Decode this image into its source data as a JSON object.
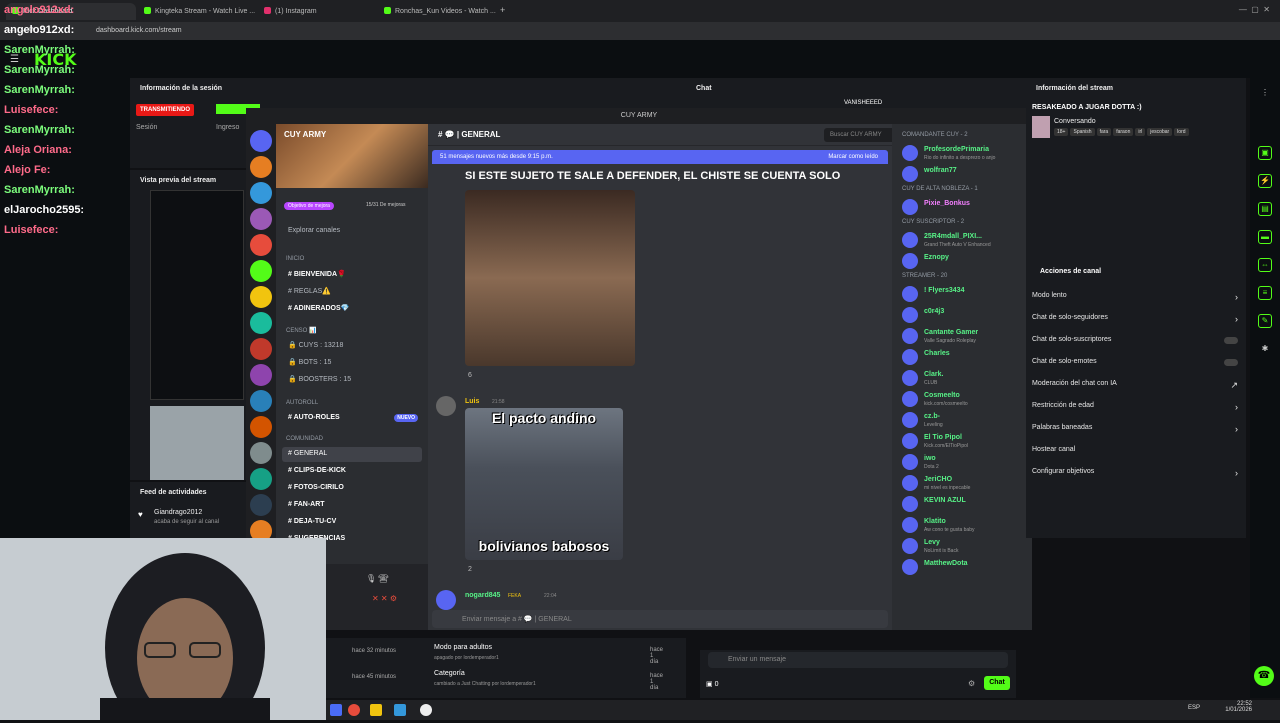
{
  "browser": {
    "tabs": [
      {
        "label": "Kick Dashboard",
        "color": "#53fc18"
      },
      {
        "label": "Kingteka Stream - Watch Live ...",
        "color": "#53fc18"
      },
      {
        "label": "(1) Instagram",
        "color": "#e1306c"
      },
      {
        "label": "Ronchas_Kun Videos - Watch ...",
        "color": "#53fc18"
      }
    ],
    "new_tab": "+",
    "url": "dashboard.kick.com/stream"
  },
  "overlay_chat": [
    {
      "user": "angelo912xd:",
      "color": "#ffffff"
    },
    {
      "user": "SarenMyrrah:",
      "color": "#7cfc7c"
    },
    {
      "user": "SarenMyrrah:",
      "color": "#7cfc7c"
    },
    {
      "user": "SarenMyrrah:",
      "color": "#7cfc7c"
    },
    {
      "user": "Luisefece:",
      "color": "#ff6b8a"
    },
    {
      "user": "SarenMyrrah:",
      "color": "#7cfc7c"
    },
    {
      "user": "Aleja Oriana:",
      "color": "#ff6b8a"
    },
    {
      "user": "Alejo Fe:",
      "color": "#ff6b8a"
    },
    {
      "user": "SarenMyrrah:",
      "color": "#7cfc7c"
    },
    {
      "user": "elJarocho2595:",
      "color": "#ffffff"
    },
    {
      "user": "Luisefece:",
      "color": "#ff6b8a"
    }
  ],
  "kick": {
    "logo": "KICK",
    "session_title": "Información de la sesión",
    "transmitting": "TRANSMITIENDO",
    "session_label": "Sesión",
    "income_label": "Ingreso",
    "preview_title": "Vista previa del stream",
    "activity_title": "Feed de actividades",
    "feed": [
      {
        "user": "Giandrago2012",
        "action": "acaba de seguir al canal"
      }
    ],
    "feed_bottom": [
      {
        "ago": "hace 32 minutos",
        "title": "Modo para adultos",
        "detail": "apagado por lordemperador1",
        "when": "hace 1 día"
      },
      {
        "ago": "hace 45 minutos",
        "title": "Categoría",
        "detail": "cambiado a Just Chatting por lordemperador1",
        "when": "hace 1 día"
      }
    ],
    "chat_title": "Chat",
    "chat_top_user": "VANISHEEED",
    "chat_input_placeholder": "Enviar un mensaje",
    "chat_button": "Chat",
    "points": "0",
    "stream_info_title": "Información del stream",
    "stream_title": "RESAKEADO A JUGAR DOTTA :)",
    "stream_category": "Conversando",
    "tags": [
      "18+",
      "Spanish",
      "fara",
      "faraon",
      "irl",
      "jescobar",
      "lord"
    ],
    "channel_actions_title": "Acciones de canal",
    "actions": [
      {
        "label": "Modo lento",
        "kind": "chev"
      },
      {
        "label": "Chat de solo-seguidores",
        "kind": "chev"
      },
      {
        "label": "Chat de solo-suscriptores",
        "kind": "toggle"
      },
      {
        "label": "Chat de solo-emotes",
        "kind": "toggle"
      },
      {
        "label": "Moderación del chat con IA",
        "kind": "link"
      },
      {
        "label": "Restricción de edad",
        "kind": "chev"
      },
      {
        "label": "Palabras baneadas",
        "kind": "chev"
      },
      {
        "label": "Hostear canal",
        "kind": "none"
      },
      {
        "label": "Configurar objetivos",
        "kind": "chev"
      }
    ]
  },
  "discord": {
    "window_title": "CUY ARMY",
    "server_name": "CUY ARMY",
    "boost_goal": "Objetivo de mejora",
    "boost_count": "15/31 De mejoras",
    "explore": "Explorar canales",
    "categories": [
      {
        "name": "INICIO",
        "channels": [
          "BIENVENIDA🌹",
          "REGLAS⚠️",
          "ADINERADOS💎"
        ]
      },
      {
        "name": "CENSO 📊",
        "channels": [
          "CUYS : 13218",
          "BOTS : 15",
          "BOOSTERS : 15"
        ]
      },
      {
        "name": "AUTOROLL",
        "channels": [
          "AUTO-ROLES"
        ]
      },
      {
        "name": "COMUNIDAD",
        "channels": [
          "GENERAL",
          "CLIPS-DE-KICK",
          "FOTOS-CIRILO",
          "FAN-ART",
          "DEJA-TU-CV",
          "SUGERENCIAS"
        ]
      }
    ],
    "new_badge": "NUEVO",
    "channel_header": "GENERAL",
    "search_placeholder": "Buscar CUY ARMY",
    "new_messages": "51 mensajes nuevos más desde 9:15 p.m.",
    "mark_read": "Marcar como leído",
    "message1_text": "SI ESTE SUJETO TE SALE A DEFENDER, EL CHISTE SE CUENTA SOLO",
    "message1_reaction": "6",
    "message2_user": "Luis",
    "message2_time": "21:58",
    "meme_top": "El pacto andino",
    "meme_bottom": "bolivianos babosos",
    "message2_reaction": "2",
    "message3_user": "nogard845",
    "message3_tag": "FEKA",
    "message3_time": "22:04",
    "input_placeholder": "Enviar mensaje a # 💬 | GENERAL",
    "members": [
      {
        "cat": "COMANDANTE CUY - 2"
      },
      {
        "name": "ProfesordePrimaria",
        "sub": "Rio do infinito a desprezo o anjo",
        "color": "#57f287"
      },
      {
        "name": "wolfran77",
        "sub": "",
        "color": "#57f287"
      },
      {
        "cat": "CUY DE ALTA NOBLEZA - 1"
      },
      {
        "name": "Pixie_Bonkus",
        "sub": "",
        "color": "#f47fff"
      },
      {
        "cat": "CUY SUSCRIPTOR - 2"
      },
      {
        "name": "25R4mdall_PIXI...",
        "sub": "Grand Theft Auto V Enhanced",
        "color": "#57f287"
      },
      {
        "name": "Eznopy",
        "sub": "",
        "color": "#57f287"
      },
      {
        "cat": "STREAMER - 20"
      },
      {
        "name": "! Flyers3434",
        "sub": "",
        "color": "#57f287"
      },
      {
        "name": "c0r4j3",
        "sub": "",
        "color": "#57f287"
      },
      {
        "name": "Cantante Gamer",
        "sub": "Valle Sagrado Roleplay",
        "color": "#57f287"
      },
      {
        "name": "Charles",
        "sub": "",
        "color": "#57f287"
      },
      {
        "name": "Clark.",
        "sub": "CLUB",
        "color": "#57f287"
      },
      {
        "name": "Cosmeelto",
        "sub": "kick.com/cosmeelto",
        "color": "#57f287"
      },
      {
        "name": "cz.b-",
        "sub": "Leveling",
        "color": "#57f287"
      },
      {
        "name": "El Tio Pipol",
        "sub": "Kick.com/ElTioPipol",
        "color": "#57f287"
      },
      {
        "name": "iwo",
        "sub": "Dota 2",
        "color": "#57f287"
      },
      {
        "name": "JeriCHO",
        "sub": "mi nivel es inpecable",
        "color": "#57f287"
      },
      {
        "name": "KEVIN AZUL",
        "sub": "",
        "color": "#57f287"
      },
      {
        "name": "Klatito",
        "sub": "Aw cono te gusta baby",
        "color": "#57f287"
      },
      {
        "name": "Levy",
        "sub": "NoLimit is Back",
        "color": "#57f287"
      },
      {
        "name": "MatthewDota",
        "sub": "",
        "color": "#57f287"
      }
    ]
  },
  "taskbar": {
    "lang": "ESP",
    "time": "22:52",
    "date": "1/01/2026"
  }
}
